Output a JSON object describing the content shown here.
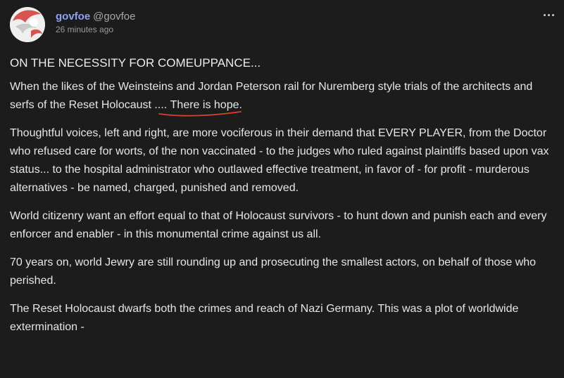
{
  "post": {
    "author": {
      "display_name": "govfoe",
      "handle": "@govfoe",
      "avatar_icon": "avatar-logo-icon"
    },
    "timestamp": "26 minutes ago",
    "menu_icon": "more-options-icon",
    "title": "ON THE NECESSITY FOR COMEUPPANCE...",
    "paragraph1_main": "When the likes of the Weinsteins and Jordan Peterson rail for Nuremberg style trials of the architects and serfs of the Reset Holocaust .... ",
    "paragraph1_highlight": "There is hope.",
    "highlight_color": "#d8422b",
    "paragraphs": [
      "Thoughtful voices, left and right, are more vociferous in their demand that EVERY PLAYER, from the Doctor who refused care for worts, of the non vaccinated - to the judges who ruled against plaintiffs based upon vax status... to the hospital administrator who outlawed effective treatment, in favor of - for profit - murderous alternatives - be named, charged, punished and removed.",
      "World citizenry want an effort equal to that of Holocaust survivors - to hunt down and punish each and every enforcer and enabler - in this monumental crime against us all.",
      "70 years on, world Jewry are still rounding up and prosecuting the smallest actors, on behalf of those who perished.",
      "The Reset Holocaust dwarfs both the crimes and reach of Nazi Germany. This was a plot of worldwide extermination -"
    ]
  },
  "colors": {
    "background": "#1c1c1c",
    "username": "#8ba3f0",
    "text": "#e6e6e6",
    "muted": "#9a9a9a",
    "avatar_red": "#d9534f"
  }
}
